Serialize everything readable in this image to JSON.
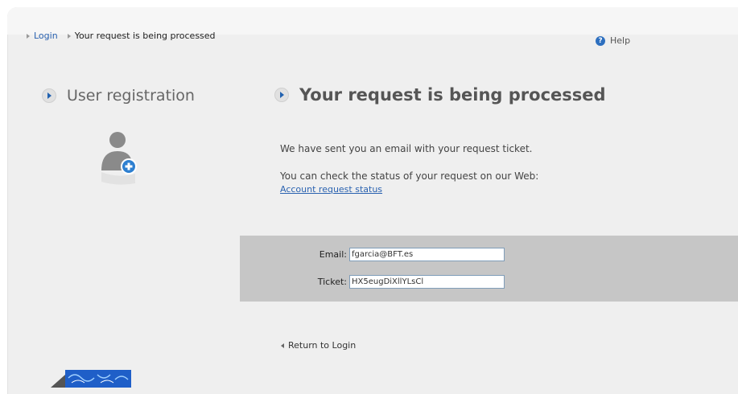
{
  "breadcrumb": {
    "login_label": "Login",
    "current_label": "Your request is being processed"
  },
  "header": {
    "help_label": "Help"
  },
  "sidebar": {
    "title": "User registration"
  },
  "main": {
    "title": "Your request is being processed",
    "email_sent_message": "We have sent you an email with your request ticket.",
    "status_message": "You can check the status of your request on our Web:",
    "status_link_label": "Account request status"
  },
  "form": {
    "email_label": "Email:",
    "email_value": "fgarcia@BFT.es",
    "ticket_label": "Ticket:",
    "ticket_value": "HX5eugDiXllYLsCl"
  },
  "footer": {
    "return_label": "Return to Login"
  },
  "colors": {
    "link": "#2a62b0",
    "accent": "#2262b0",
    "band": "#c6c6c6",
    "panel": "#efefef"
  }
}
